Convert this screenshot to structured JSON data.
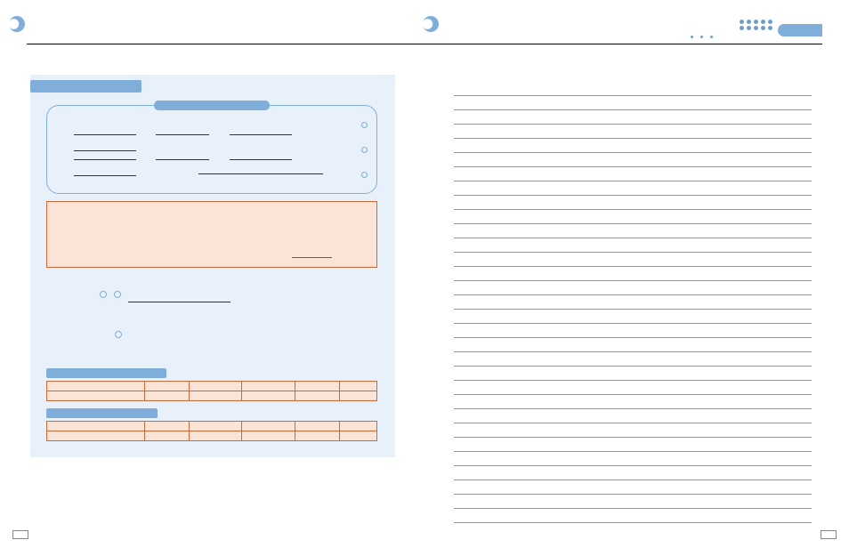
{
  "header": {
    "decorations": [
      "half-moon-left",
      "half-moon-center",
      "dots",
      "cluster",
      "tab"
    ]
  },
  "left_panel": {
    "title": "",
    "rounded_box": {
      "title": "",
      "row1": [
        "",
        "",
        "",
        ""
      ],
      "row2": [
        "",
        "",
        "",
        ""
      ],
      "row3": "",
      "bullets": [
        "",
        "",
        ""
      ]
    },
    "peach_box_text": "",
    "mid_section": {
      "bullets": [
        "",
        ""
      ],
      "line_text": "",
      "extra_bullet": ""
    },
    "subtitle1": "",
    "table1": {
      "rows": 2,
      "cols": 6
    },
    "subtitle2": "",
    "table2": {
      "rows": 2,
      "cols": 6
    }
  },
  "lined_paper_lines": 31,
  "footer": {
    "left": "",
    "right": ""
  }
}
